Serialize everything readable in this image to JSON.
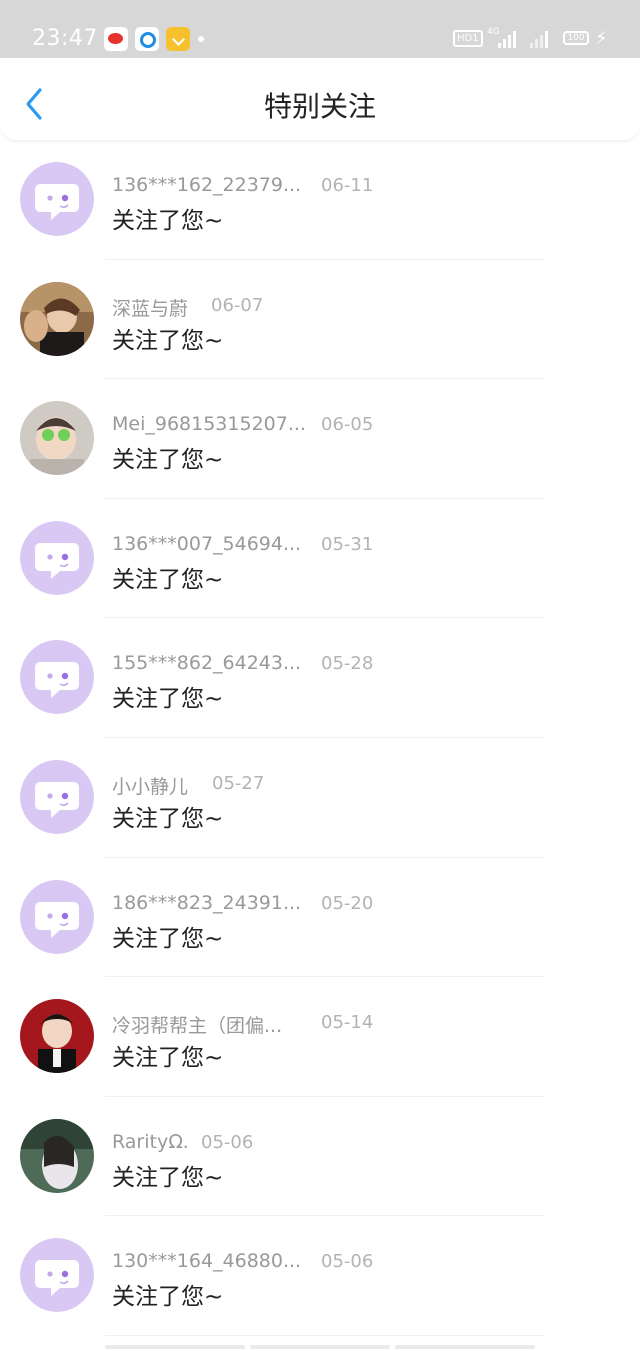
{
  "status_bar": {
    "time": "23:47",
    "app_icons": [
      "weibo-icon",
      "blue-app-icon",
      "yellow-app-icon"
    ],
    "hd_label": "HD1",
    "network_label": "4G",
    "battery_level": "100"
  },
  "header": {
    "title": "特别关注",
    "back_icon": "chevron-left-icon"
  },
  "colors": {
    "accent": "#2a9af0",
    "default_avatar_bg": "#d9c8f4",
    "name_text": "#999999",
    "date_text": "#b3b3b3",
    "message_text": "#222222"
  },
  "notifications": [
    {
      "name": "136***162_22379...",
      "date": "06-11",
      "message": "关注了您~",
      "avatar": "default-chat-avatar"
    },
    {
      "name": "深蓝与蔚",
      "date": "06-07",
      "message": "关注了您~",
      "avatar": "photo-avatar"
    },
    {
      "name": "Mei_96815315207...",
      "date": "06-05",
      "message": "关注了您~",
      "avatar": "photo-avatar"
    },
    {
      "name": "136***007_54694...",
      "date": "05-31",
      "message": "关注了您~",
      "avatar": "default-chat-avatar"
    },
    {
      "name": "155***862_64243...",
      "date": "05-28",
      "message": "关注了您~",
      "avatar": "default-chat-avatar"
    },
    {
      "name": "小小静儿",
      "date": "05-27",
      "message": "关注了您~",
      "avatar": "default-chat-avatar"
    },
    {
      "name": "186***823_24391...",
      "date": "05-20",
      "message": "关注了您~",
      "avatar": "default-chat-avatar"
    },
    {
      "name": "冷羽帮帮主（团偏...",
      "date": "05-14",
      "message": "关注了您~",
      "avatar": "photo-avatar"
    },
    {
      "name": "RarityΩ.",
      "date": "05-06",
      "message": "关注了您~",
      "avatar": "photo-avatar"
    },
    {
      "name": "130***164_46880...",
      "date": "05-06",
      "message": "关注了您~",
      "avatar": "default-chat-avatar"
    }
  ]
}
